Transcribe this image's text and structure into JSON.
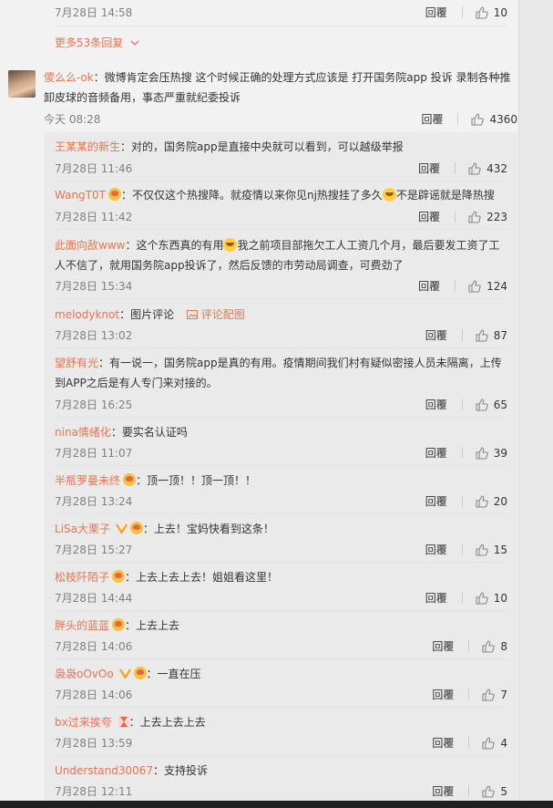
{
  "top_row": {
    "time": "7月28日 14:58",
    "reply": "回覆",
    "likes": "10"
  },
  "more_replies": "更多53条回复",
  "main_comment": {
    "author": "儍么么-ok",
    "text": "：微博肯定会压热搜 这个时候正确的处理方式应该是 打开国务院app 投诉 录制各种推卸皮球的音频备用，事态严重就纪委投诉",
    "time": "今天 08:28",
    "reply": "回覆",
    "likes": "4360"
  },
  "replies": [
    {
      "author": "王某某的新生",
      "text": "：对的，国务院app是直接中央就可以看到，可以越级举报",
      "time": "7月28日 11:46",
      "reply": "回覆",
      "likes": "432"
    },
    {
      "author": "WangT0T",
      "text_a": "：不仅仅这个热搜降。就疫情以来你见nj热搜挂了多久",
      "text_b": "不是辟谣就是降热搜",
      "time": "7月28日 11:42",
      "reply": "回覆",
      "likes": "223"
    },
    {
      "author": "此面向敌www",
      "text_a": "：这个东西真的有用",
      "text_b": "我之前项目部拖欠工人工资几个月，最后要发工资了工人不信了，就用国务院app投诉了，然后反馈的市劳动局调查，可费劲了",
      "time": "7月28日 15:34",
      "reply": "回覆",
      "likes": "124"
    },
    {
      "author": "melodyknot",
      "text": "：图片评论",
      "pic_link": "评论配图",
      "time": "7月28日 13:02",
      "reply": "回覆",
      "likes": "87"
    },
    {
      "author": "望舒有光",
      "text": "：有一说一，国务院app是真的有用。疫情期间我们村有疑似密接人员未隔离，上传到APP之后是有人专门来对接的。",
      "time": "7月28日 16:25",
      "reply": "回覆",
      "likes": "65"
    },
    {
      "author": "nina情绪化",
      "text": "：要实名认证吗",
      "time": "7月28日 11:07",
      "reply": "回覆",
      "likes": "39"
    },
    {
      "author": "半瓶罗曼未终",
      "text": "：顶一顶！！顶一顶！！",
      "time": "7月28日 13:24",
      "reply": "回覆",
      "likes": "20"
    },
    {
      "author": "LiSa大栗子",
      "text": "：上去！宝妈快看到这条！",
      "time": "7月28日 15:27",
      "reply": "回覆",
      "likes": "15"
    },
    {
      "author": "松枝阡陌子",
      "text": "：上去上去上去！姐姐看这里！",
      "time": "7月28日 14:44",
      "reply": "回覆",
      "likes": "10"
    },
    {
      "author": "胖头的蓝蓝",
      "text": "：上去上去",
      "time": "7月28日 14:06",
      "reply": "回覆",
      "likes": "8"
    },
    {
      "author": "袅袅oOvOo",
      "text": "：一直在压",
      "time": "7月28日 14:06",
      "reply": "回覆",
      "likes": "7"
    },
    {
      "author": "bx过来挨夸",
      "text": "：上去上去上去",
      "time": "7月28日 13:59",
      "reply": "回覆",
      "likes": "4"
    },
    {
      "author": "Understand30067",
      "text": "：支持投诉",
      "time": "7月28日 12:11",
      "reply": "回覆",
      "likes": "5"
    }
  ],
  "colors": {
    "name": "#eb7350",
    "text": "#333333",
    "time": "#808080",
    "badge": "#f5c342"
  },
  "icons": [
    "thumbs-up-icon",
    "chevron-down-icon",
    "image-icon",
    "vip-v-icon",
    "member-badge-icon",
    "emoji-icon",
    "hourglass-icon"
  ]
}
